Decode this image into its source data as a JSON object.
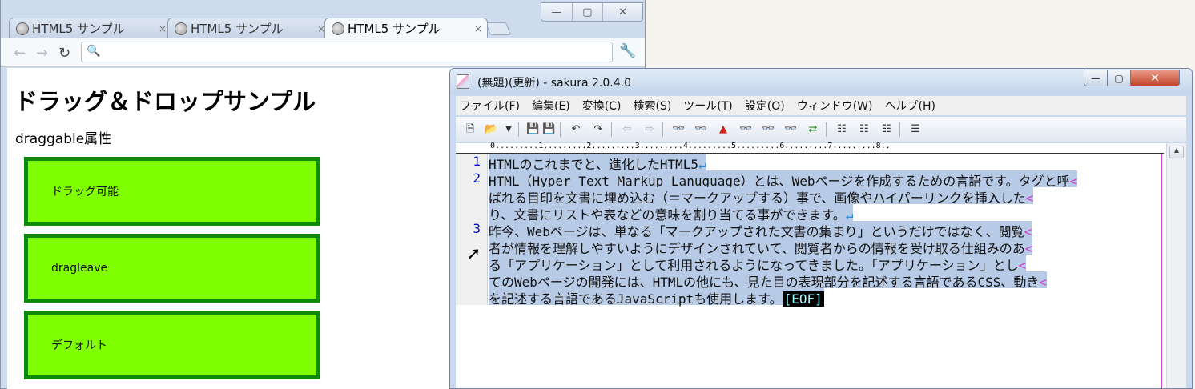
{
  "browser": {
    "tabs": [
      {
        "label": "HTML5 サンプル",
        "close": "×"
      },
      {
        "label": "HTML5 サンプル",
        "close": "×"
      },
      {
        "label": "HTML5 サンプル",
        "close": "×"
      }
    ],
    "window_buttons": {
      "minimize": "—",
      "maximize": "▢",
      "close": "✕"
    },
    "nav": {
      "back": "←",
      "forward": "→",
      "reload": "↻"
    },
    "omnibox_value": "",
    "page": {
      "heading": "ドラッグ＆ドロップサンプル",
      "subheading": "draggable属性",
      "boxes": [
        {
          "label": "ドラッグ可能"
        },
        {
          "label": "dragleave"
        },
        {
          "label": "デフォルト"
        }
      ],
      "box_fill": "#80ff00",
      "box_border": "#0d8a0d"
    }
  },
  "editor": {
    "title": "(無題)(更新) - sakura 2.0.4.0",
    "window_buttons": {
      "minimize": "—",
      "maximize": "▢",
      "close": "✕"
    },
    "menu": [
      "ファイル(F)",
      "編集(E)",
      "変換(C)",
      "検索(S)",
      "ツール(T)",
      "設定(O)",
      "ウィンドウ(W)",
      "ヘルプ(H)"
    ],
    "ruler": "0.........1.........2.........3.........4.........5.........6.........7.........8..",
    "lines": [
      {
        "num": "1",
        "rows": [
          "HTMLのこれまでと、進化したHTML5"
        ],
        "ending": "↵"
      },
      {
        "num": "2",
        "rows": [
          "HTML（Hyper Text Markup Lanuguage）とは、Webページを作成するための言語です。タグと呼",
          "ばれる目印を文書に埋め込む（＝マークアップする）事で、画像やハイパーリンクを挿入した",
          "り、文書にリストや表などの意味を割り当てる事ができます。"
        ],
        "ending": "↵"
      },
      {
        "num": "3",
        "rows": [
          "昨今、Webページは、単なる「マークアップされた文書の集まり」というだけではなく、閲覧",
          "者が情報を理解しやすいようにデザインされていて、閲覧者からの情報を受け取る仕組みのあ",
          "る「アプリケーション」として利用されるようになってきました。「アプリケーション」とし",
          "てのWebページの開発には、HTMLの他にも、見た目の表現部分を記述する言語であるCSS、動き",
          "を記述する言語であるJavaScriptも使用します。"
        ],
        "ending": "[EOF]"
      }
    ],
    "wrap_mark": "<",
    "selection_color": "#b7cbe6"
  }
}
